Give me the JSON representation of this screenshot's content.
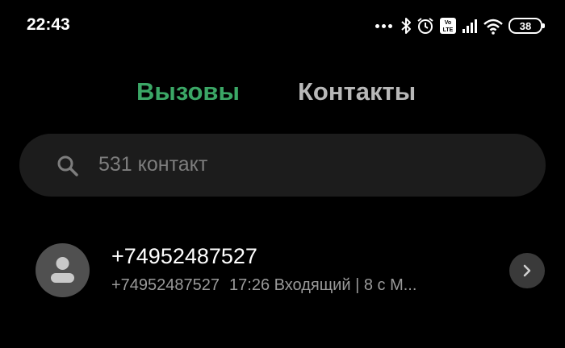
{
  "status_bar": {
    "time": "22:43",
    "battery_level": "38",
    "volte_label": "Vo LTE",
    "icons": [
      "more-dots-icon",
      "bluetooth-icon",
      "alarm-icon",
      "volte-icon",
      "signal-icon",
      "wifi-icon",
      "battery-icon"
    ]
  },
  "tabs": [
    {
      "label": "Вызовы",
      "active": true
    },
    {
      "label": "Контакты",
      "active": false
    }
  ],
  "search": {
    "placeholder": "531 контакт",
    "icon": "search-icon"
  },
  "calls": [
    {
      "title": "+74952487527",
      "number": "+74952487527",
      "details": "17:26 Входящий | 8 с  М...",
      "avatar_icon": "person-icon",
      "action_icon": "chevron-right-icon"
    }
  ],
  "colors": {
    "background": "#000000",
    "accent": "#3ba766",
    "search_bg": "#1c1c1c",
    "secondary_text": "#9a9a9a"
  }
}
